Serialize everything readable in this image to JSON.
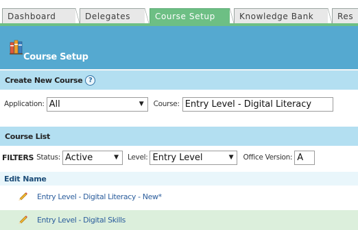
{
  "tabs": [
    {
      "label": "Dashboard",
      "active": false
    },
    {
      "label": "Delegates",
      "active": false
    },
    {
      "label": "Course Setup",
      "active": true
    },
    {
      "label": "Knowledge Bank",
      "active": false
    },
    {
      "label": "Res",
      "active": false
    }
  ],
  "header": {
    "title": "Course Setup",
    "icon": "books-icon"
  },
  "create_section": {
    "title": "Create New Course",
    "application_label": "Application:",
    "application_value": "All",
    "course_label": "Course:",
    "course_value": "Entry Level - Digital Literacy"
  },
  "course_list": {
    "title": "Course List",
    "filters_label": "FILTERS",
    "status_label": "Status:",
    "status_value": "Active",
    "level_label": "Level:",
    "level_value": "Entry Level",
    "office_label": "Office Version:",
    "office_value": "A"
  },
  "table": {
    "columns": [
      "Edit",
      "Name"
    ],
    "rows": [
      {
        "name": "Entry Level - Digital Literacy - New*"
      },
      {
        "name": "Entry Level - Digital Skills"
      }
    ]
  },
  "colors": {
    "active_tab": "#6dbf84",
    "header": "#55a9d0",
    "section_bar": "#b3dff1",
    "row_highlight": "#dcefdc",
    "link": "#2b5d9c"
  }
}
